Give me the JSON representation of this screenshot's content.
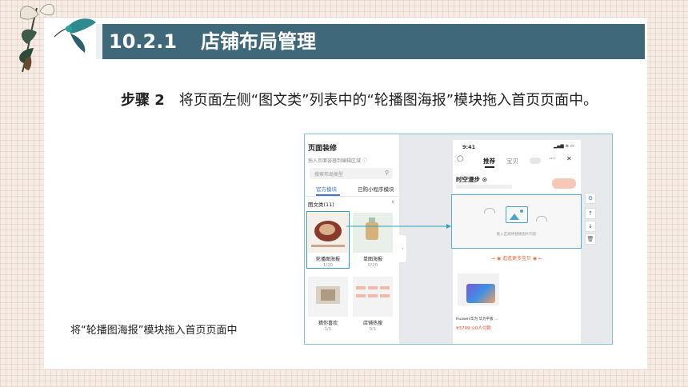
{
  "title": {
    "number": "10.2.1",
    "text": "店铺布局管理"
  },
  "body": {
    "step": "步骤 2",
    "text": "将页面左侧“图文类”列表中的“轮播图海报”模块拖入首页页面中。"
  },
  "caption": "将“轮播图海报”模块拖入首页页面中",
  "screenshot": {
    "left_panel": {
      "title": "页面装修",
      "hint": "拖入页面容器到编辑区域 ⓘ",
      "search_placeholder": "搜索布局类型",
      "tabs": [
        "官方模块",
        "已购小程序模块"
      ],
      "section": "图文类(11)",
      "cards": [
        {
          "name": "轮播图海报",
          "count": "1/20"
        },
        {
          "name": "单图海报",
          "count": "0/20"
        },
        {
          "name": "猜你喜欢",
          "count": "1/1"
        },
        {
          "name": "店铺热搜",
          "count": "0/1"
        }
      ]
    },
    "phone": {
      "time": "9:41",
      "status": "▂▄▆ ≋ ▭",
      "tabs": [
        "推荐",
        "宝贝"
      ],
      "dots": "···",
      "close": "✕",
      "store_name": "时空漫步 ⊙",
      "drop_hint": "拖入区域将替换图片内容",
      "more_label": "→ ◉ 逛逛更多宝贝 ◉ ←",
      "product_name": "Huawei/华为 华为平板 ...",
      "product_price": "¥3799 ⊙0人付款"
    },
    "controls": [
      "⚙",
      "↑",
      "↓",
      "🗑"
    ]
  }
}
